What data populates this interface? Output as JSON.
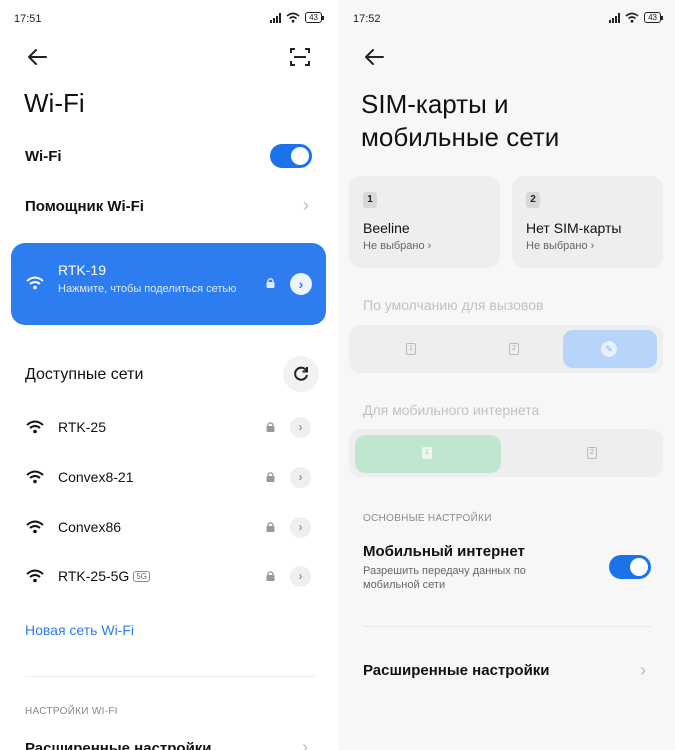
{
  "left": {
    "status": {
      "time": "17:51",
      "battery": "43"
    },
    "title": "Wi-Fi",
    "wifi_toggle": {
      "label": "Wi-Fi",
      "on": true
    },
    "assistant_label": "Помощник Wi-Fi",
    "connected": {
      "name": "RTK-19",
      "subtitle": "Нажмите, чтобы поделиться сетью"
    },
    "available_label": "Доступные сети",
    "networks": [
      {
        "name": "RTK-25",
        "tag": ""
      },
      {
        "name": "Convex8-21",
        "tag": ""
      },
      {
        "name": "Convex86",
        "tag": ""
      },
      {
        "name": "RTK-25-5G",
        "tag": "5G"
      }
    ],
    "new_network": "Новая сеть Wi-Fi",
    "section_settings": "НАСТРОЙКИ WI-FI",
    "advanced": "Расширенные настройки"
  },
  "right": {
    "status": {
      "time": "17:52",
      "battery": "43"
    },
    "title": "SIM-карты и мобильные сети",
    "sims": [
      {
        "slot": "1",
        "carrier": "Beeline",
        "state": "Не выбрано ›"
      },
      {
        "slot": "2",
        "carrier": "Нет SIM-карты",
        "state": "Не выбрано ›"
      }
    ],
    "calls_label": "По умолчанию для вызовов",
    "calls_options": [
      "1",
      "2"
    ],
    "data_label": "Для мобильного интернета",
    "data_options": [
      "1",
      "2"
    ],
    "section_basic": "ОСНОВНЫЕ НАСТРОЙКИ",
    "mobile_data": {
      "title": "Мобильный интернет",
      "subtitle": "Разрешить передачу данных по мобильной сети",
      "on": true
    },
    "advanced": "Расширенные настройки"
  },
  "colors": {
    "accent": "#2d7cf0",
    "toggle_on": "#1a73e8",
    "selected_green": "#bfe7d0",
    "selected_blue": "#b7d4fb"
  },
  "icons": [
    "back-arrow-icon",
    "qr-scan-icon",
    "wifi-icon",
    "lock-icon",
    "chevron-right-icon",
    "refresh-icon",
    "edit-icon",
    "sim-card-icon"
  ]
}
